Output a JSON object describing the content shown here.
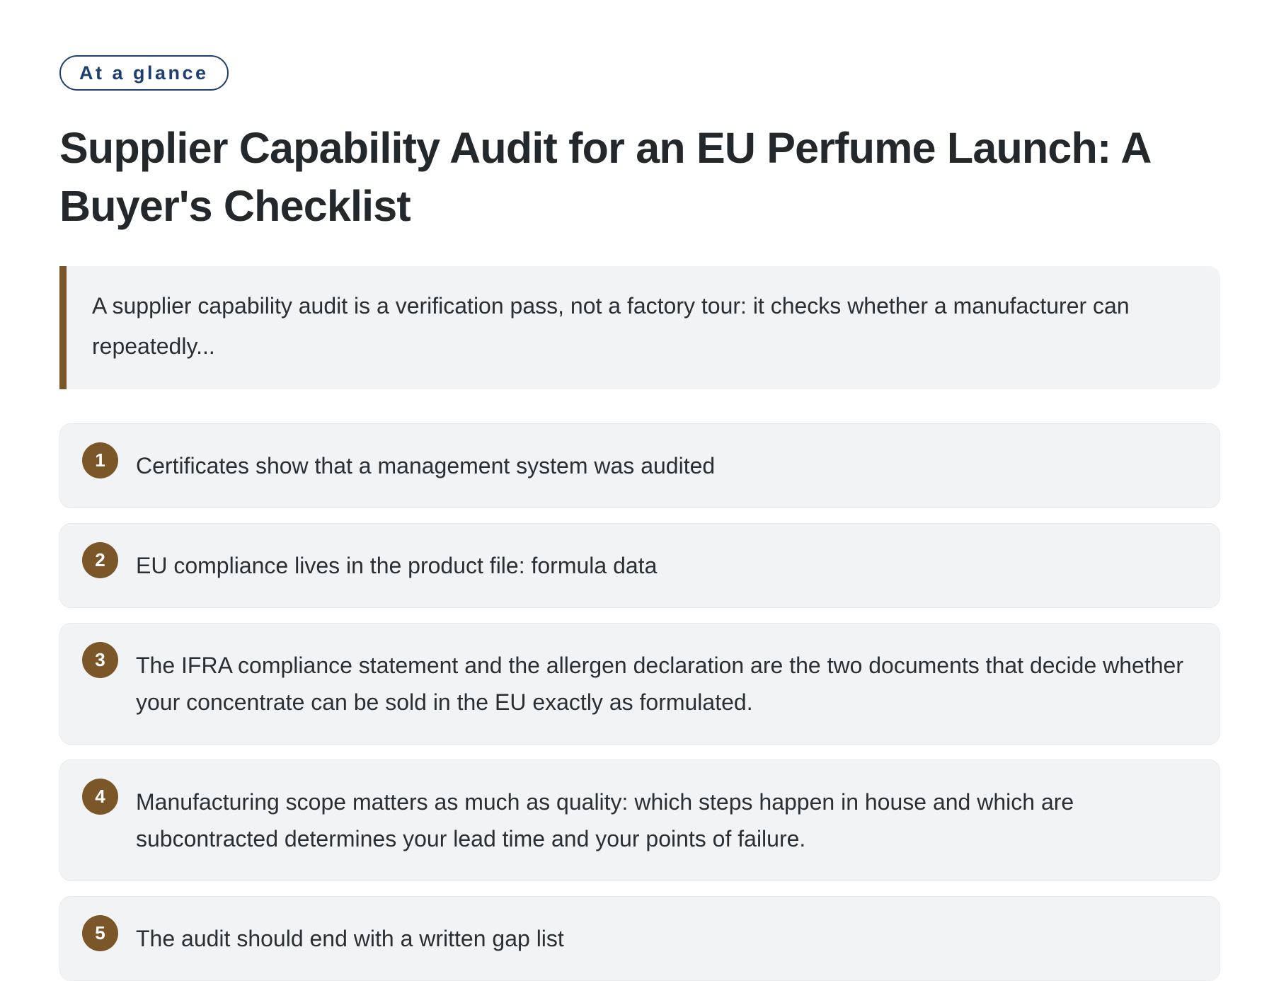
{
  "badge": {
    "label": "At a glance"
  },
  "title": "Supplier Capability Audit for an EU Perfume Launch: A Buyer's Checklist",
  "summary": "A supplier capability audit is a verification pass, not a factory tour: it checks whether a manufacturer can repeatedly...",
  "colors": {
    "accent": "#7a5628",
    "badge": "#1f3f73",
    "card_background": "#f2f3f5",
    "text": "#23282c"
  },
  "points": [
    {
      "number": "1",
      "text": "Certificates show that a management system was audited"
    },
    {
      "number": "2",
      "text": "EU compliance lives in the product file: formula data"
    },
    {
      "number": "3",
      "text": "The IFRA compliance statement and the allergen declaration are the two documents that decide whether your concentrate can be sold in the EU exactly as formulated."
    },
    {
      "number": "4",
      "text": "Manufacturing scope matters as much as quality: which steps happen in house and which are subcontracted determines your lead time and your points of failure."
    },
    {
      "number": "5",
      "text": "The audit should end with a written gap list"
    }
  ]
}
